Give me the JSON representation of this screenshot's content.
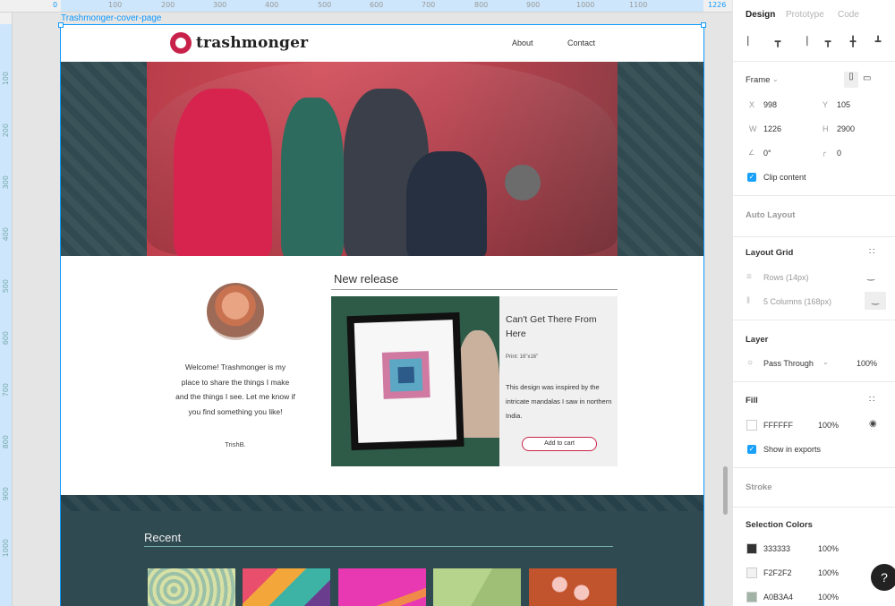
{
  "ruler": {
    "top_ticks": [
      "0",
      "100",
      "200",
      "300",
      "400",
      "500",
      "600",
      "700",
      "800",
      "900",
      "1000",
      "1100",
      "1226"
    ],
    "left_ticks": [
      "100",
      "200",
      "300",
      "400",
      "500",
      "600",
      "700",
      "800",
      "900",
      "1000"
    ]
  },
  "canvas": {
    "frame_label": "Trashmonger-cover-page"
  },
  "site": {
    "brand": "trashmonger",
    "nav": {
      "about": "About",
      "contact": "Contact"
    },
    "welcome": "Welcome! Trashmonger is my place to share the things I make and the things I see. Let me know if you find something you like!",
    "signoff": "TrishB.",
    "new_release": {
      "heading": "New release",
      "title": "Can't Get There From Here",
      "print_label": "Print: 16\"x16\"",
      "description": "This design was inspired by the intricate mandalas I saw in northern India.",
      "button": "Add to cart"
    },
    "recent": {
      "heading": "Recent"
    }
  },
  "panel": {
    "tabs": {
      "design": "Design",
      "prototype": "Prototype",
      "code": "Code"
    },
    "frame": {
      "title": "Frame",
      "x_label": "X",
      "x": "998",
      "y_label": "Y",
      "y": "105",
      "w_label": "W",
      "w": "1226",
      "h_label": "H",
      "h": "2900",
      "rotation": "0°",
      "radius": "0",
      "clip_content": "Clip content"
    },
    "auto_layout": "Auto Layout",
    "layout_grid": {
      "title": "Layout Grid",
      "rows": "Rows (14px)",
      "columns": "5 Columns (168px)"
    },
    "layer": {
      "title": "Layer",
      "blend": "Pass Through",
      "opacity": "100%"
    },
    "fill": {
      "title": "Fill",
      "hex": "FFFFFF",
      "opacity": "100%",
      "show_in_exports": "Show in exports"
    },
    "stroke": "Stroke",
    "selection_colors": {
      "title": "Selection Colors",
      "items": [
        {
          "hex": "333333",
          "opacity": "100%",
          "color": "#333333"
        },
        {
          "hex": "F2F2F2",
          "opacity": "100%",
          "color": "#F2F2F2"
        },
        {
          "hex": "A0B3A4",
          "opacity": "100%",
          "color": "#A0B3A4"
        }
      ]
    },
    "help": "?"
  },
  "colors": {
    "accent": "#0d99ff",
    "brand": "#c8224a",
    "teal": "#2f4a50"
  }
}
